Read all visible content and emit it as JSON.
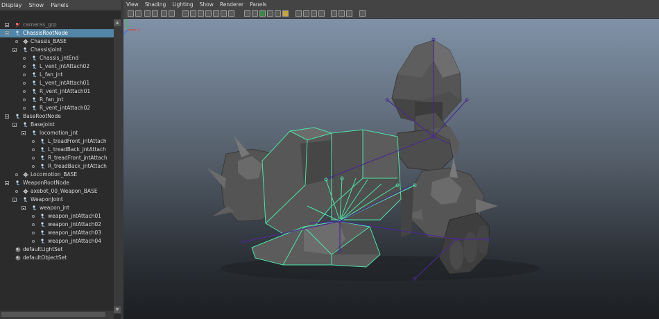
{
  "outliner": {
    "menu": [
      "Display",
      "Show",
      "Panels"
    ],
    "items": [
      {
        "label": "cameras_grp",
        "dim": true
      },
      {
        "label": "ChassisRootNode",
        "selected": true
      },
      {
        "label": "Chassis_BASE"
      },
      {
        "label": "ChassisJoint"
      },
      {
        "label": "Chassis_jntEnd"
      },
      {
        "label": "L_vent_jntAttach02"
      },
      {
        "label": "L_fan_jnt"
      },
      {
        "label": "L_vent_jntAttach01"
      },
      {
        "label": "R_vent_jntAttach01"
      },
      {
        "label": "R_fan_jnt"
      },
      {
        "label": "R_vent_jntAttach02"
      },
      {
        "label": "BaseRootNode"
      },
      {
        "label": "BaseJoint"
      },
      {
        "label": "locomotion_jnt"
      },
      {
        "label": "L_treadFront_jntAttach"
      },
      {
        "label": "L_treadBack_jntAttach"
      },
      {
        "label": "R_treadFront_jntAttach"
      },
      {
        "label": "R_treadBack_jntAttach"
      },
      {
        "label": "Locomotion_BASE"
      },
      {
        "label": "WeaponRootNode"
      },
      {
        "label": "axebot_00_Weapon_BASE"
      },
      {
        "label": "WeaponJoint"
      },
      {
        "label": "weapon_jnt"
      },
      {
        "label": "weapon_jntAttach01"
      },
      {
        "label": "weapon_jntAttach02"
      },
      {
        "label": "weapon_jntAttach03"
      },
      {
        "label": "weapon_jntAttach04"
      },
      {
        "label": "defaultLightSet"
      },
      {
        "label": "defaultObjectSet"
      }
    ]
  },
  "viewport": {
    "menu": [
      "View",
      "Shading",
      "Lighting",
      "Show",
      "Renderer",
      "Panels"
    ],
    "axis": {
      "x": "X",
      "y": "Y",
      "z": "Z"
    },
    "colors": {
      "wireframe": "#4de5a8",
      "joint": "#4a2a8c"
    }
  }
}
